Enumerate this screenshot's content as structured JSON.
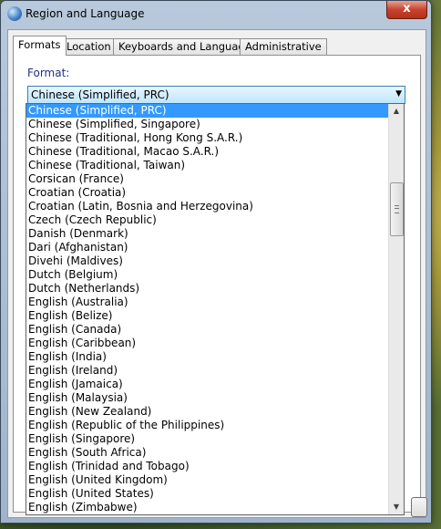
{
  "window": {
    "title": "Region and Language",
    "close_label": "x"
  },
  "tabs": [
    {
      "label": "Formats",
      "active": true
    },
    {
      "label": "Location",
      "active": false
    },
    {
      "label": "Keyboards and Languages",
      "active": false
    },
    {
      "label": "Administrative",
      "active": false
    }
  ],
  "format": {
    "label": "Format:",
    "selected": "Chinese (Simplified, PRC)"
  },
  "dropdown": {
    "options": [
      "Chinese (Simplified, PRC)",
      "Chinese (Simplified, Singapore)",
      "Chinese (Traditional, Hong Kong S.A.R.)",
      "Chinese (Traditional, Macao S.A.R.)",
      "Chinese (Traditional, Taiwan)",
      "Corsican (France)",
      "Croatian (Croatia)",
      "Croatian (Latin, Bosnia and Herzegovina)",
      "Czech (Czech Republic)",
      "Danish (Denmark)",
      "Dari (Afghanistan)",
      "Divehi (Maldives)",
      "Dutch (Belgium)",
      "Dutch (Netherlands)",
      "English (Australia)",
      "English (Belize)",
      "English (Canada)",
      "English (Caribbean)",
      "English (India)",
      "English (Ireland)",
      "English (Jamaica)",
      "English (Malaysia)",
      "English (New Zealand)",
      "English (Republic of the Philippines)",
      "English (Singapore)",
      "English (South Africa)",
      "English (Trinidad and Tobago)",
      "English (United Kingdom)",
      "English (United States)",
      "English (Zimbabwe)"
    ],
    "selected_index": 0
  },
  "colors": {
    "selection": "#3399ff",
    "close_button": "#c7432d",
    "label_blue": "#1e3287"
  }
}
